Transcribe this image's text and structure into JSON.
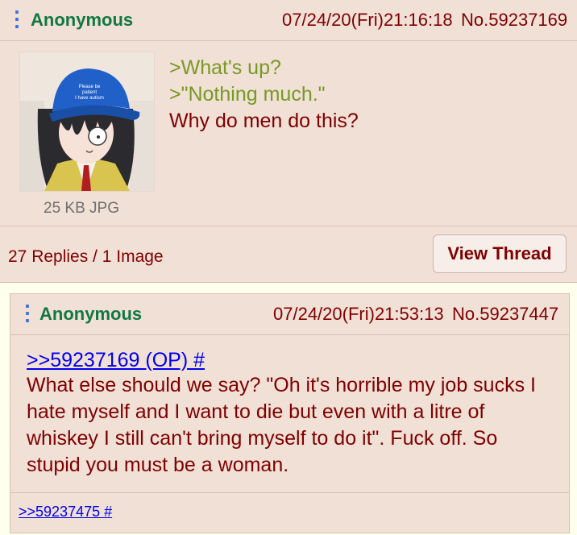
{
  "op": {
    "name": "Anonymous",
    "datetime": "07/24/20(Fri)21:16:18",
    "post_no": "No.59237169",
    "file_info": "25 KB JPG",
    "cap_text_lines": [
      "Please be",
      "patient",
      "I have autism"
    ],
    "greentext": [
      ">What's up?",
      ">\"Nothing much.\""
    ],
    "body": "Why do men do this?",
    "replies_summary": "27 Replies / 1 Image",
    "view_thread_label": "View Thread"
  },
  "reply": {
    "name": "Anonymous",
    "datetime": "07/24/20(Fri)21:53:13",
    "post_no": "No.59237447",
    "quote_link": ">>59237169 (OP) #",
    "body_lines": [
      "What else should we say? \"Oh it's horrible my job sucks I",
      "hate myself and I want to die but even with a litre of",
      "whiskey I still can't bring myself to do it\". Fuck off. So",
      "stupid you must be a woman."
    ],
    "backlink": ">>59237475 #"
  },
  "colors": {
    "post_bg": "#f0e0d6",
    "page_bg": "#ffffee",
    "name": "#117743",
    "text": "#800000",
    "greentext": "#789922",
    "link": "#0000ee",
    "menu": "#3a6ee0"
  },
  "icons": [
    "menu-dots-icon"
  ]
}
